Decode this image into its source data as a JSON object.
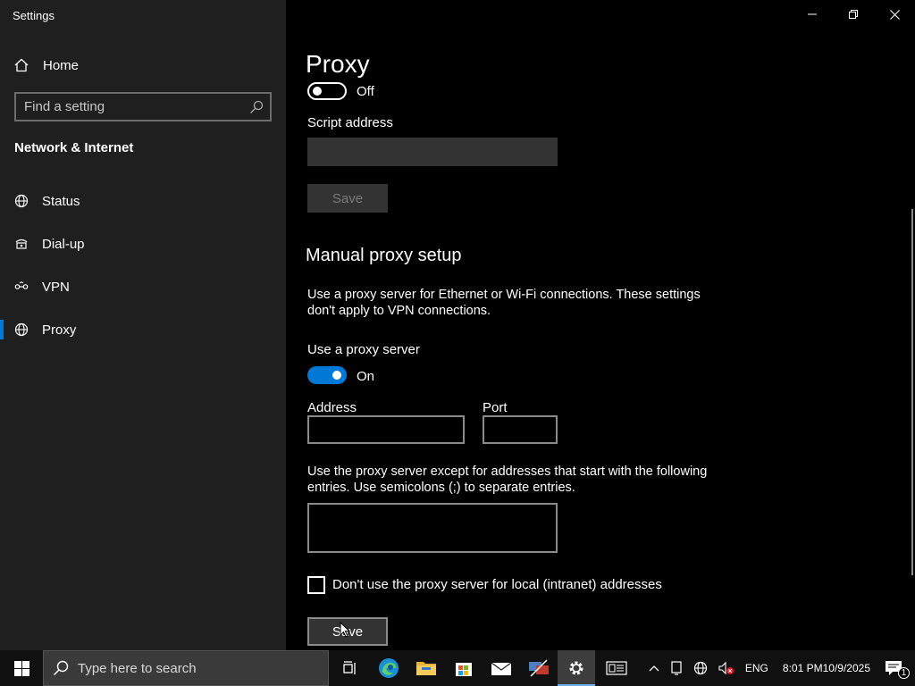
{
  "window": {
    "title": "Settings"
  },
  "sidebar": {
    "home_label": "Home",
    "search_placeholder": "Find a setting",
    "section_title": "Network & Internet",
    "items": [
      {
        "label": "Status",
        "icon": "globe-status-icon",
        "active": false
      },
      {
        "label": "Dial-up",
        "icon": "dial-up-icon",
        "active": false
      },
      {
        "label": "VPN",
        "icon": "vpn-icon",
        "active": false
      },
      {
        "label": "Proxy",
        "icon": "globe-icon",
        "active": true
      }
    ]
  },
  "main": {
    "page_title": "Proxy",
    "auto_script": {
      "toggle_state": "Off",
      "script_address_label": "Script address",
      "script_address_value": "",
      "save_label": "Save"
    },
    "manual": {
      "heading": "Manual proxy setup",
      "description": "Use a proxy server for Ethernet or Wi-Fi connections. These settings don't apply to VPN connections.",
      "use_proxy_label": "Use a proxy server",
      "toggle_state": "On",
      "address_label": "Address",
      "address_value": "",
      "port_label": "Port",
      "port_value": "",
      "exceptions_description": "Use the proxy server except for addresses that start with the following entries. Use semicolons (;) to separate entries.",
      "exceptions_value": "",
      "local_checkbox_label": "Don't use the proxy server for local (intranet) addresses",
      "local_checkbox_checked": false,
      "save_label": "Save"
    }
  },
  "taskbar": {
    "search_placeholder": "Type here to search",
    "apps": [
      "task-view-icon",
      "edge-icon",
      "file-explorer-icon",
      "store-icon",
      "mail-icon",
      "network-tool-icon",
      "settings-icon"
    ],
    "tray": {
      "language": "ENG",
      "time": "8:01 PM",
      "date": "10/9/2025",
      "notification_count": "1"
    }
  },
  "colors": {
    "accent": "#0078d7",
    "sidebar_bg": "#1f1f1f",
    "main_bg": "#000000",
    "taskbar_bg": "#101010"
  }
}
